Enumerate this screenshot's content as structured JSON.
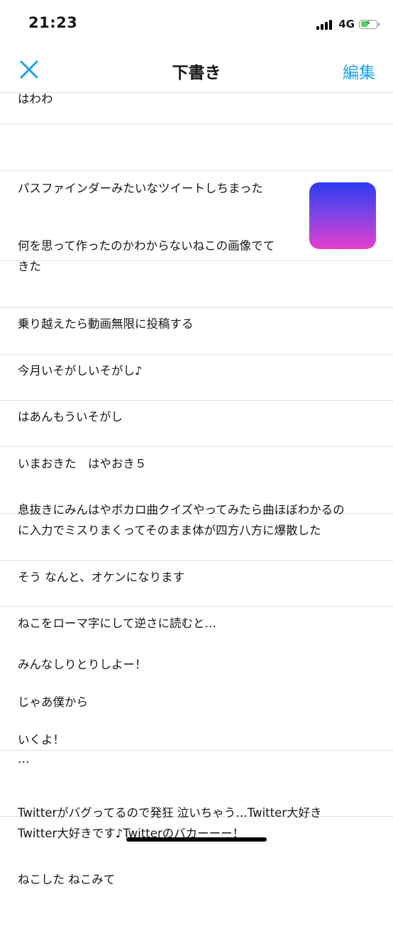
{
  "status": {
    "time": "21:23",
    "network": "4G",
    "battery_level": 0.4
  },
  "nav": {
    "title": "下書き",
    "edit_label": "編集"
  },
  "drafts": [
    "はわわ",
    "パスファインダーみたいなツイートしちまった",
    "何を思って作ったのかわからないねこの画像でて\nきた",
    "乗り越えたら動画無限に投稿する",
    "今月いそがしいそがし♪",
    "はあんもういそがし",
    "いまおきた　はやおき５",
    "息抜きにみんはやボカロ曲クイズやってみたら曲ほぼわかるの\nに入力でミスりまくってそのまま体が四方八方に爆散した",
    "そう なんと、オケンになります",
    "ねこをローマ字にして逆さに読むと…",
    "みんなしりとりしよー！\n\nじゃあ僕から\n\nいくよ！\n…",
    "Twitterがバグってるので発狂 泣いちゃう…Twitter大好き\nTwitter大好きです♪Twitterのバカーーー！",
    "ねこした ねこみて"
  ],
  "colors": {
    "accent": "#1da1f2",
    "divider": "#dde2e6"
  },
  "icons": {
    "close": "close-icon",
    "thumbnail": "cat-image-thumbnail"
  }
}
